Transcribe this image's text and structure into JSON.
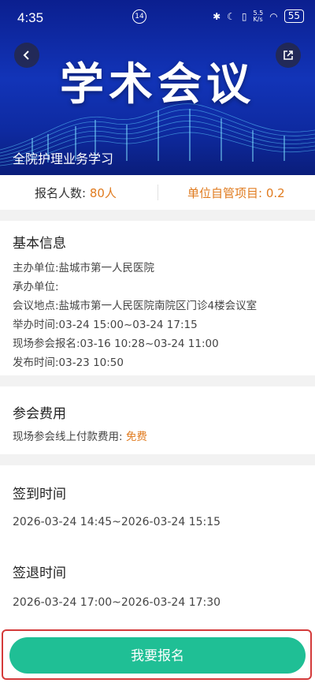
{
  "status_bar": {
    "time": "4:35",
    "net_speed_top": "5.5",
    "net_speed_bottom": "K/s",
    "battery": "55",
    "notif_badge": "14"
  },
  "header": {
    "title": "学术会议",
    "subtitle": "全院护理业务学习"
  },
  "stats": {
    "signup_label": "报名人数:",
    "signup_value": "80人",
    "credit_label": "单位自管项目: 0.2"
  },
  "basic_info": {
    "title": "基本信息",
    "rows": [
      "主办单位:盐城市第一人民医院",
      "承办单位:",
      "会议地点:盐城市第一人民医院南院区门诊4楼会议室",
      "举办时间:03-24 15:00~03-24 17:15",
      "现场参会报名:03-16 10:28~03-24 11:00",
      "发布时间:03-23 10:50"
    ]
  },
  "fee": {
    "title": "参会费用",
    "label": "现场参会线上付款费用:",
    "value": "免费"
  },
  "checkin": {
    "title": "签到时间",
    "value": "2026-03-24 14:45~2026-03-24 15:15"
  },
  "checkout": {
    "title": "签退时间",
    "value": "2026-03-24 17:00~2026-03-24 17:30"
  },
  "footer": {
    "button_label": "我要报名"
  },
  "colors": {
    "accent_orange": "#e07b1f",
    "button_green": "#1fbf95",
    "hero_blue": "#1234b8",
    "highlight_red": "#d43a3a"
  }
}
